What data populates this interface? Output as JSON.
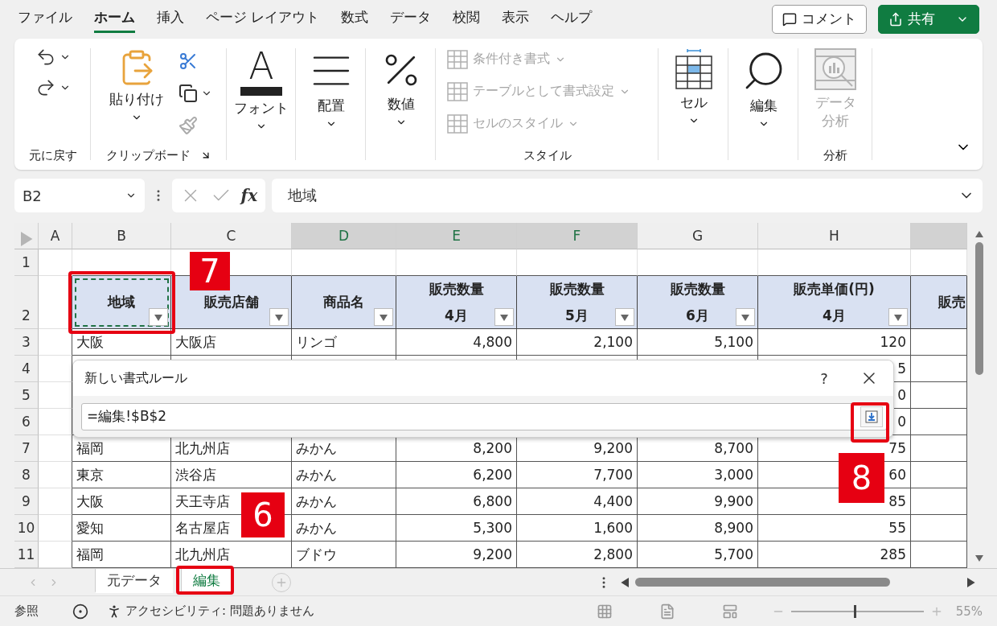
{
  "menu_tabs": [
    {
      "label": "ファイル",
      "selected": false
    },
    {
      "label": "ホーム",
      "selected": true
    },
    {
      "label": "挿入",
      "selected": false
    },
    {
      "label": "ページ レイアウト",
      "selected": false
    },
    {
      "label": "数式",
      "selected": false
    },
    {
      "label": "データ",
      "selected": false
    },
    {
      "label": "校閲",
      "selected": false
    },
    {
      "label": "表示",
      "selected": false
    },
    {
      "label": "ヘルプ",
      "selected": false
    }
  ],
  "header_buttons": [
    {
      "kind": "comment",
      "label": "コメント"
    },
    {
      "kind": "share",
      "label": "共有"
    }
  ],
  "ribbon": {
    "groups": [
      {
        "kind": "undo",
        "label": "元に戻す"
      },
      {
        "kind": "clipboard",
        "label": "クリップボード",
        "paste": "貼り付け"
      },
      {
        "kind": "font",
        "glyph": "A",
        "button": "フォント"
      },
      {
        "kind": "align",
        "button": "配置"
      },
      {
        "kind": "number",
        "button": "数値"
      },
      {
        "kind": "styles",
        "label": "スタイル",
        "items": [
          {
            "label": "条件付き書式",
            "disabled": true
          },
          {
            "label": "テーブルとして書式設定",
            "disabled": true
          },
          {
            "label": "セルのスタイル",
            "disabled": true
          }
        ]
      },
      {
        "kind": "cells",
        "button": "セル"
      },
      {
        "kind": "find",
        "button": "編集"
      },
      {
        "kind": "analysis",
        "label": "分析",
        "button": [
          "データ",
          "分析"
        ],
        "disabled": true
      }
    ]
  },
  "formula_bar": {
    "name_box": "B2",
    "fx": "fx",
    "formula": "地域"
  },
  "columns": [
    {
      "letter": "A",
      "selected": false
    },
    {
      "letter": "B",
      "selected": false
    },
    {
      "letter": "C",
      "selected": false
    },
    {
      "letter": "D",
      "selected": true
    },
    {
      "letter": "E",
      "selected": true
    },
    {
      "letter": "F",
      "selected": true
    },
    {
      "letter": "G",
      "selected": false
    },
    {
      "letter": "H",
      "selected": false
    },
    {
      "selected": true
    }
  ],
  "rows": [
    {
      "number": "1",
      "kind": "blank"
    },
    {
      "number": "2",
      "kind": "header",
      "cells": [
        {
          "lines": [
            "地域"
          ],
          "filter": true,
          "copy_marquee": true
        },
        {
          "lines": [
            "販売店舗"
          ],
          "filter": true,
          "copy_marquee": false
        },
        {
          "lines": [
            "商品名"
          ],
          "filter": true,
          "copy_marquee": false
        },
        {
          "lines": [
            "販売数量",
            "4月"
          ],
          "filter": true,
          "copy_marquee": false
        },
        {
          "lines": [
            "販売数量",
            "5月"
          ],
          "filter": true,
          "copy_marquee": false
        },
        {
          "lines": [
            "販売数量",
            "6月"
          ],
          "filter": true,
          "copy_marquee": false
        },
        {
          "lines": [
            "販売単価(円)",
            "4月"
          ],
          "filter": true,
          "copy_marquee": false
        },
        {
          "lines": [
            "販売"
          ],
          "filter": false,
          "copy_marquee": false
        }
      ]
    },
    {
      "number": "3",
      "kind": "data",
      "cells": [
        "大阪",
        "大阪店",
        "リンゴ",
        "4,800",
        "2,100",
        "5,100",
        "120"
      ]
    },
    {
      "number": "4",
      "kind": "covered",
      "tail": "5"
    },
    {
      "number": "5",
      "kind": "covered",
      "tail": "0"
    },
    {
      "number": "6",
      "kind": "covered",
      "tail": "0"
    },
    {
      "number": "7",
      "kind": "data",
      "cells": [
        "福岡",
        "北九州店",
        "みかん",
        "8,200",
        "9,200",
        "8,700",
        "75"
      ]
    },
    {
      "number": "8",
      "kind": "data",
      "cells": [
        "東京",
        "渋谷店",
        "みかん",
        "6,200",
        "7,700",
        "3,000",
        "60"
      ]
    },
    {
      "number": "9",
      "kind": "data",
      "cells": [
        "大阪",
        "天王寺店",
        "みかん",
        "6,800",
        "4,400",
        "9,900",
        "85"
      ]
    },
    {
      "number": "10",
      "kind": "data",
      "cells": [
        "愛知",
        "名古屋店",
        "みかん",
        "5,300",
        "1,600",
        "8,900",
        "55"
      ]
    },
    {
      "number": "11",
      "kind": "data",
      "cells": [
        "福岡",
        "北九州店",
        "ブドウ",
        "9,200",
        "2,800",
        "5,700",
        "285"
      ]
    }
  ],
  "dialog": {
    "title": "新しい書式ルール",
    "help": "?",
    "value": "=編集!$B$2"
  },
  "sheet_tabs": [
    {
      "label": "元データ",
      "selected": false
    },
    {
      "label": "編集",
      "selected": true
    }
  ],
  "status_bar": {
    "mode": "参照",
    "accessibility": "アクセシビリティ: 問題ありません",
    "zoom": {
      "level": 0.48,
      "reading": "55%"
    }
  },
  "annotations": [
    {
      "kind": "frame"
    },
    {
      "kind": "badge",
      "text": "7"
    },
    {
      "kind": "badge",
      "text": "6"
    },
    {
      "kind": "frame"
    },
    {
      "kind": "badge",
      "text": "8"
    },
    {
      "kind": "frame"
    }
  ]
}
